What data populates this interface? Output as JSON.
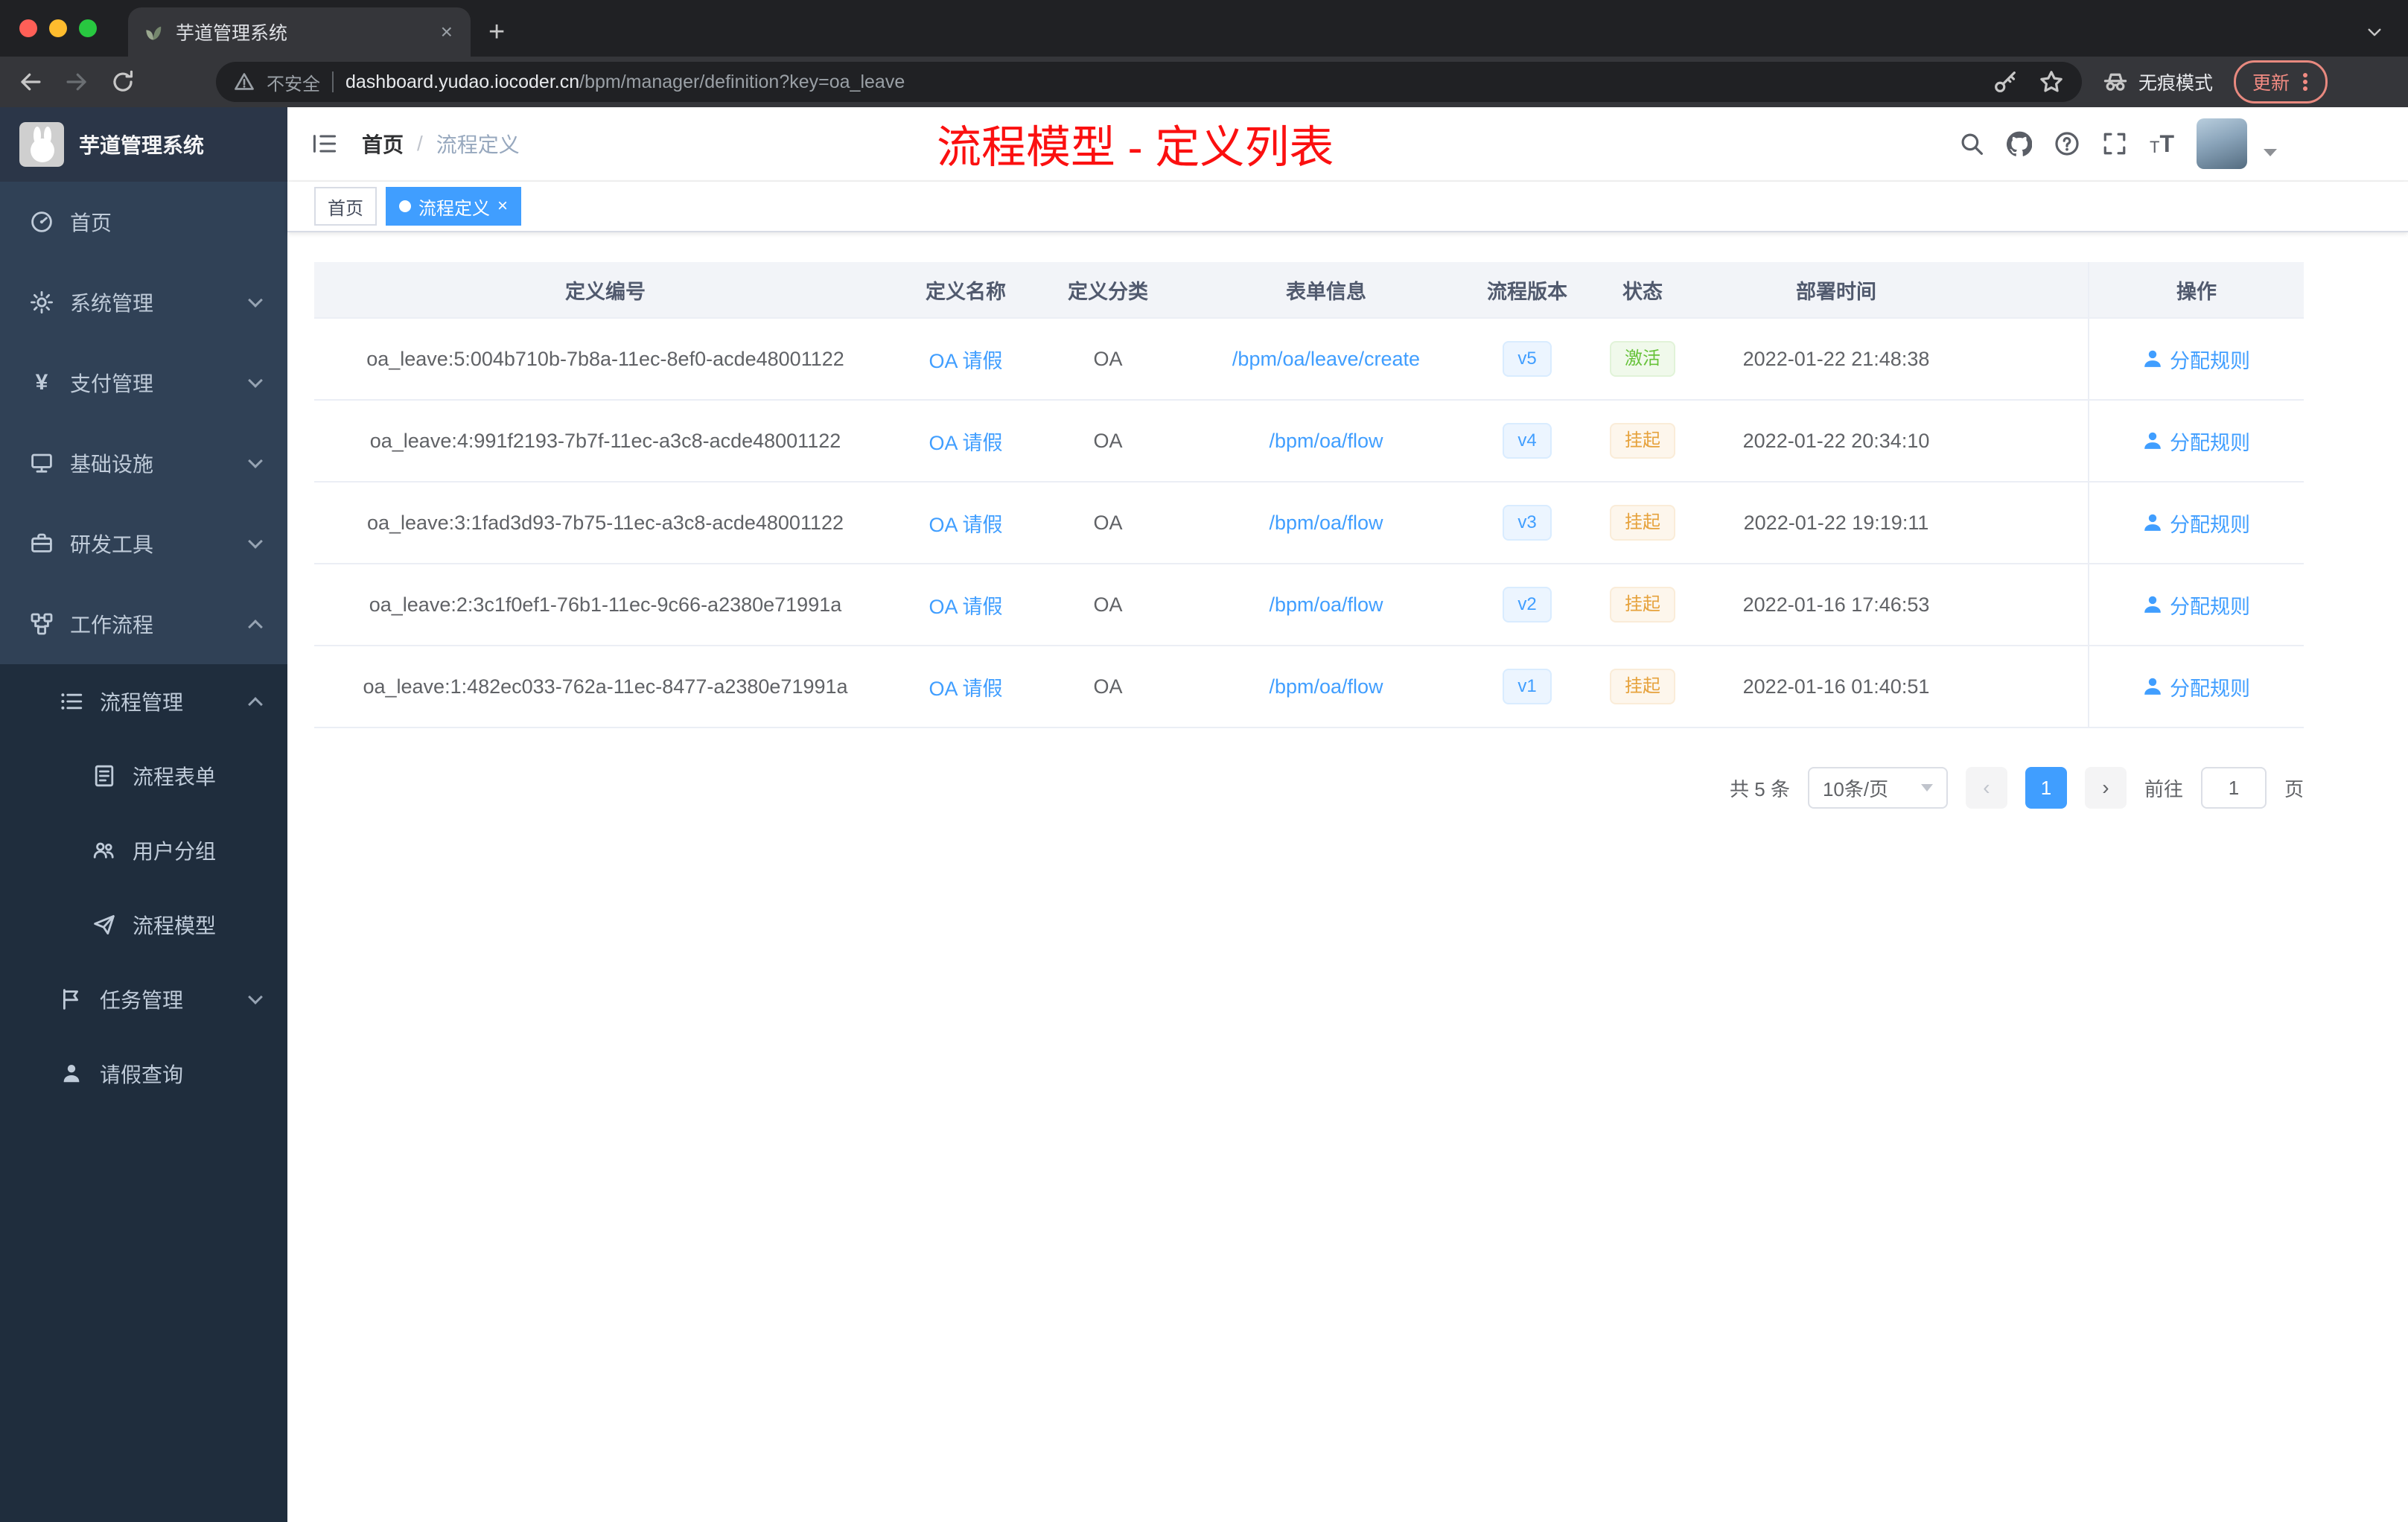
{
  "colors": {
    "accent": "#409eff",
    "success": "#67c23a",
    "warning": "#e6a23c",
    "annotation_red": "#fb1010",
    "sidebar_bg": "#304156",
    "submenu_bg": "#1f2d3d"
  },
  "browser": {
    "tab_title": "芋道管理系统",
    "security_label": "不安全",
    "url_host": "dashboard.yudao.iocoder.cn",
    "url_path": "/bpm/manager/definition?key=oa_leave",
    "incognito_label": "无痕模式",
    "update_label": "更新"
  },
  "sidebar": {
    "title": "芋道管理系统",
    "menu": [
      {
        "label": "首页"
      },
      {
        "label": "系统管理"
      },
      {
        "label": "支付管理"
      },
      {
        "label": "基础设施"
      },
      {
        "label": "研发工具"
      },
      {
        "label": "工作流程"
      },
      {
        "label": "流程管理"
      },
      {
        "label": "流程表单"
      },
      {
        "label": "用户分组"
      },
      {
        "label": "流程模型"
      },
      {
        "label": "任务管理"
      },
      {
        "label": "请假查询"
      }
    ]
  },
  "navbar": {
    "breadcrumb_home": "首页",
    "breadcrumb_sep": "/",
    "breadcrumb_current": "流程定义",
    "annotation": "流程模型 - 定义列表"
  },
  "tags": [
    {
      "label": "首页"
    },
    {
      "label": "流程定义"
    }
  ],
  "table": {
    "columns": [
      "定义编号",
      "定义名称",
      "定义分类",
      "表单信息",
      "流程版本",
      "状态",
      "部署时间",
      "操作"
    ],
    "rows": [
      {
        "id": "oa_leave:5:004b710b-7b8a-11ec-8ef0-acde48001122",
        "name": "OA 请假",
        "category": "OA",
        "form": "/bpm/oa/leave/create",
        "version": "v5",
        "status": "激活",
        "time": "2022-01-22 21:48:38",
        "action": "分配规则"
      },
      {
        "id": "oa_leave:4:991f2193-7b7f-11ec-a3c8-acde48001122",
        "name": "OA 请假",
        "category": "OA",
        "form": "/bpm/oa/flow",
        "version": "v4",
        "status": "挂起",
        "time": "2022-01-22 20:34:10",
        "action": "分配规则"
      },
      {
        "id": "oa_leave:3:1fad3d93-7b75-11ec-a3c8-acde48001122",
        "name": "OA 请假",
        "category": "OA",
        "form": "/bpm/oa/flow",
        "version": "v3",
        "status": "挂起",
        "time": "2022-01-22 19:19:11",
        "action": "分配规则"
      },
      {
        "id": "oa_leave:2:3c1f0ef1-76b1-11ec-9c66-a2380e71991a",
        "name": "OA 请假",
        "category": "OA",
        "form": "/bpm/oa/flow",
        "version": "v2",
        "status": "挂起",
        "time": "2022-01-16 17:46:53",
        "action": "分配规则"
      },
      {
        "id": "oa_leave:1:482ec033-762a-11ec-8477-a2380e71991a",
        "name": "OA 请假",
        "category": "OA",
        "form": "/bpm/oa/flow",
        "version": "v1",
        "status": "挂起",
        "time": "2022-01-16 01:40:51",
        "action": "分配规则"
      }
    ]
  },
  "pagination": {
    "total": "共 5 条",
    "page_size": "10条/页",
    "page": "1",
    "goto_label": "前往",
    "goto_value": "1",
    "unit": "页"
  },
  "icons": {
    "new_tab": "+",
    "tab_close": "×",
    "tag_close": "×",
    "yen": "¥",
    "prev": "‹",
    "next": "›",
    "font_small": "T",
    "font_big": "T"
  }
}
